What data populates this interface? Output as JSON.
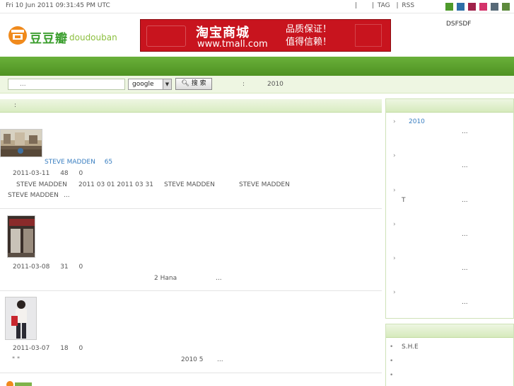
{
  "topbar": {
    "datetime": "Fri 10 Jun 2011 09:31:45 PM UTC",
    "sep1": "|",
    "sep2": "|",
    "tag_label": "TAG",
    "sep3": "|",
    "rss_label": "RSS",
    "theme_colors": [
      "#4e9a2b",
      "#2e6fa8",
      "#a0224a",
      "#d4336b",
      "#586a78",
      "#5d8a3c"
    ]
  },
  "header": {
    "logo_cn": "豆豆瓣",
    "logo_en": "doudouban",
    "banner_title": "淘宝商城",
    "banner_url": "www.tmall.com",
    "banner_slogan_1": "品质保证！",
    "banner_slogan_2": "值得信赖！",
    "note": "DSFSDF"
  },
  "search": {
    "placeholder": "...",
    "engine_selected": "google",
    "button_label": "搜 索",
    "note_colon": ":",
    "note_year": "2010"
  },
  "main": {
    "header_text": ":",
    "posts": [
      {
        "author_link": "STEVE MADDEN",
        "author_count": "65",
        "date": "2011-03-11",
        "views": "48",
        "comments": "0",
        "line1": [
          "STEVE MADDEN",
          "2011 03 01  2011 03 31",
          "STEVE MADDEN",
          "STEVE MADDEN"
        ],
        "line2": [
          "STEVE MADDEN",
          "..."
        ]
      },
      {
        "date": "2011-03-08",
        "views": "31",
        "comments": "0",
        "line1": [
          "2  Hana",
          "..."
        ]
      },
      {
        "date": "2011-03-07",
        "views": "18",
        "comments": "0",
        "quote": "\" \"",
        "line1": [
          "2010 5",
          "..."
        ]
      }
    ]
  },
  "sidebar": {
    "box1_items": [
      {
        "chevron": "›",
        "title": "2010",
        "more": "..."
      },
      {
        "chevron": "›",
        "title": "",
        "more": "..."
      },
      {
        "chevron": "›",
        "title": "T",
        "more": "..."
      },
      {
        "chevron": "›",
        "title": "",
        "more": "..."
      },
      {
        "chevron": "›",
        "title": "",
        "more": "..."
      },
      {
        "chevron": "›",
        "title": "",
        "more": "..."
      }
    ],
    "box2_items": [
      {
        "bullet": "•",
        "title": "S.H.E"
      },
      {
        "bullet": "•",
        "title": ""
      },
      {
        "bullet": "•",
        "title": ""
      }
    ]
  }
}
